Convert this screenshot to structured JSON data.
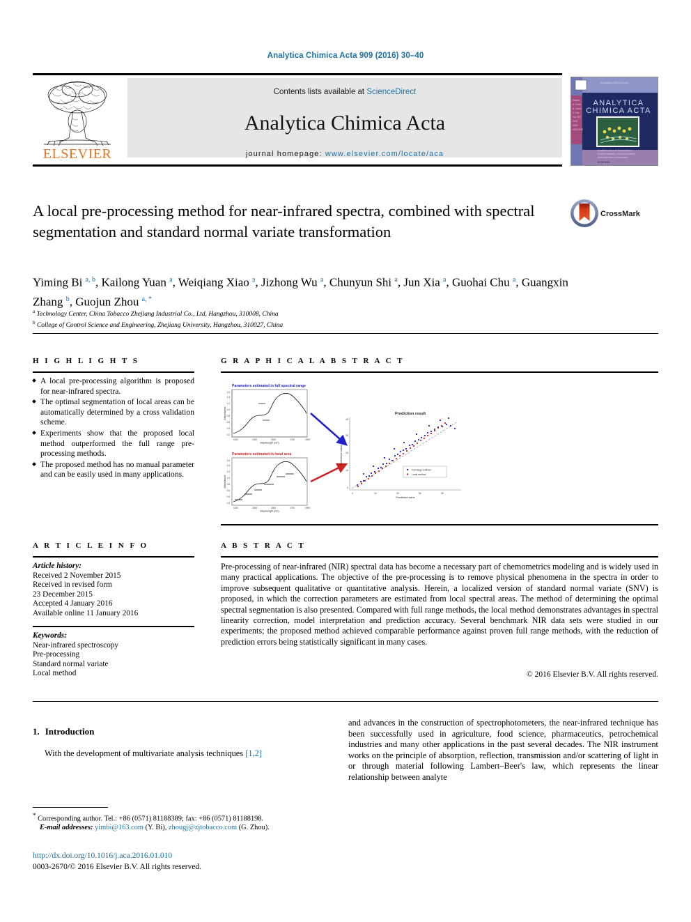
{
  "running_head": "Analytica Chimica Acta 909 (2016) 30–40",
  "banner": {
    "contents_prefix": "Contents lists available at ",
    "sciencedirect": "ScienceDirect",
    "journal_name": "Analytica Chimica Acta",
    "homepage_prefix": "journal homepage: ",
    "homepage_url": "www.elsevier.com/locate/aca",
    "publisher": "ELSEVIER",
    "cover_title_line1": "ANALYTICA",
    "cover_title_line2": "CHIMICA ACTA"
  },
  "article": {
    "title": "A local pre-processing method for near-infrared spectra, combined with spectral segmentation and standard normal variate transformation",
    "crossmark_label": "CrossMark",
    "authors_html": "Yiming Bi <sup>a, b</sup>, Kailong Yuan <sup>a</sup>, Weiqiang Xiao <sup>a</sup>, Jizhong Wu <sup>a</sup>, Chunyun Shi <sup>a</sup>, Jun Xia <sup>a</sup>, Guohai Chu <sup>a</sup>, Guangxin Zhang <sup>b</sup>, Guojun Zhou <sup>a, *</sup>",
    "affiliations": [
      "Technology Center, China Tobacco Zhejiang Industrial Co., Ltd, Hangzhou, 310008, China",
      "College of Control Science and Engineering, Zhejiang University, Hangzhou, 310027, China"
    ]
  },
  "highlights": {
    "heading": "H I G H L I G H T S",
    "items": [
      "A local pre-processing algorithm is proposed for near-infrared spectra.",
      "The optimal segmentation of local areas can be automatically determined by a cross validation scheme.",
      "Experiments show that the proposed local method outperformed the full range pre-processing methods.",
      "The proposed method has no manual parameter and can be easily used in many applications."
    ]
  },
  "graphical_abstract": {
    "heading": "G R A P H I C A L   A B S T R A C T",
    "panel_titles": {
      "top_left": "Parameters estimated in full spectral range",
      "bottom_left": "Parameters estimated in local area",
      "right": "Prediction result"
    },
    "axis_labels": {
      "left_x": "Wavelength (nm)",
      "left_y": "Absorbance",
      "right_x": "Predicted value",
      "right_y": "Reference value"
    },
    "legend": [
      "Full range method",
      "Local method"
    ]
  },
  "article_info": {
    "heading": "A R T I C L E   I N F O",
    "history_label": "Article history:",
    "history": [
      "Received 2 November 2015",
      "Received in revised form",
      "23 December 2015",
      "Accepted 4 January 2016",
      "Available online 11 January 2016"
    ],
    "keywords_label": "Keywords:",
    "keywords": [
      "Near-infrared spectroscopy",
      "Pre-processing",
      "Standard normal variate",
      "Local method"
    ]
  },
  "abstract": {
    "heading": "A B S T R A C T",
    "text": "Pre-processing of near-infrared (NIR) spectral data has become a necessary part of chemometrics modeling and is widely used in many practical applications. The objective of the pre-processing is to remove physical phenomena in the spectra in order to improve subsequent qualitative or quantitative analysis. Herein, a localized version of standard normal variate (SNV) is proposed, in which the correction parameters are estimated from local spectral areas. The method of determining the optimal spectral segmentation is also presented. Compared with full range methods, the local method demonstrates advantages in spectral linearity correction, model interpretation and prediction accuracy. Several benchmark NIR data sets were studied in our experiments; the proposed method achieved comparable performance against proven full range methods, with the reduction of prediction errors being statistically significant in many cases.",
    "copyright": "© 2016 Elsevier B.V. All rights reserved."
  },
  "body": {
    "section_number": "1.",
    "section_title": "Introduction",
    "left_paragraph_before_link": "With the development of multivariate analysis techniques ",
    "left_paragraph_link": "[1,2]",
    "right_paragraph": "and advances in the construction of spectrophotometers, the near-infrared technique has been successfully used in agriculture, food science, pharmaceutics, petrochemical industries and many other applications in the past several decades. The NIR instrument works on the principle of absorption, reflection, transmission and/or scattering of light in or through material following Lambert–Beer's law, which represents the linear relationship between analyte"
  },
  "footnote": {
    "corresponding": "Corresponding author. Tel.: +86 (0571) 81188389; fax: +86 (0571) 81188198.",
    "email_label": "E-mail addresses:",
    "email1": "yimbi@163.com",
    "email1_owner": "(Y. Bi),",
    "email2": "zhougj@zjtobacco.com",
    "email2_owner": "(G. Zhou)."
  },
  "footer": {
    "doi": "http://dx.doi.org/10.1016/j.aca.2016.01.010",
    "issn": "0003-2670/© 2016 Elsevier B.V. All rights reserved."
  },
  "colors": {
    "link_blue": "#1b72a8",
    "elsevier_orange": "#e87424",
    "banner_grey": "#e6e6e6",
    "plot_blue": "#2222cc",
    "plot_red": "#cc2222"
  }
}
